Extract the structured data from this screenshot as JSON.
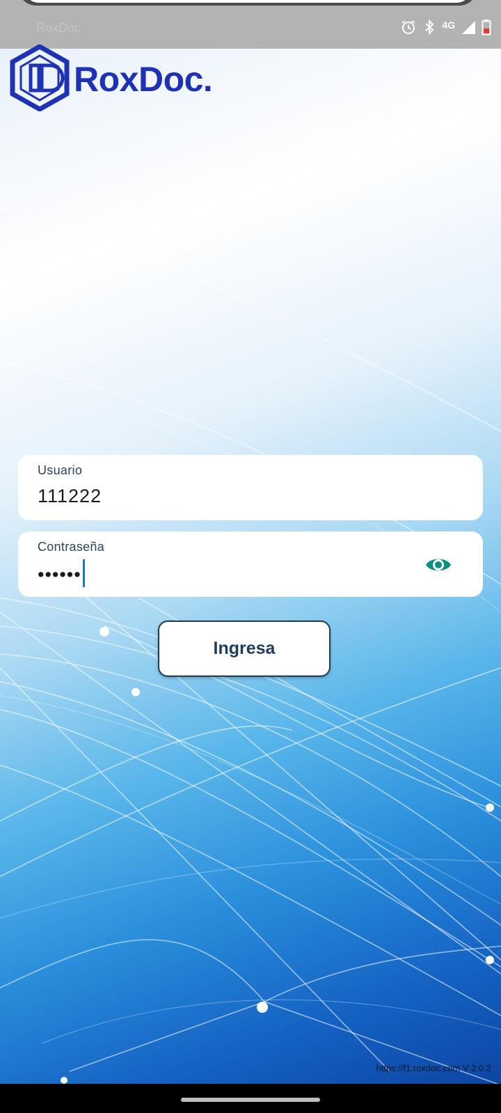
{
  "status_bar": {
    "title": "RoxDoc",
    "network_label": "4G",
    "icons": [
      "alarm-icon",
      "bluetooth-icon",
      "signal-icon",
      "battery-icon"
    ]
  },
  "logo": {
    "text": "RoxDoc."
  },
  "form": {
    "usuario": {
      "label": "Usuario",
      "value": "111222"
    },
    "password": {
      "label": "Contraseña",
      "value": "••••••",
      "toggle_icon": "eye-icon"
    },
    "submit_label": "Ingresa"
  },
  "footer": {
    "version_text": "https://f1.roxdoc.com V 2.0.2"
  },
  "colors": {
    "brand": "#1f32b4",
    "button_text": "#1f3d5c",
    "eye_icon": "#0d8f7e",
    "cursor": "#1976d2"
  }
}
